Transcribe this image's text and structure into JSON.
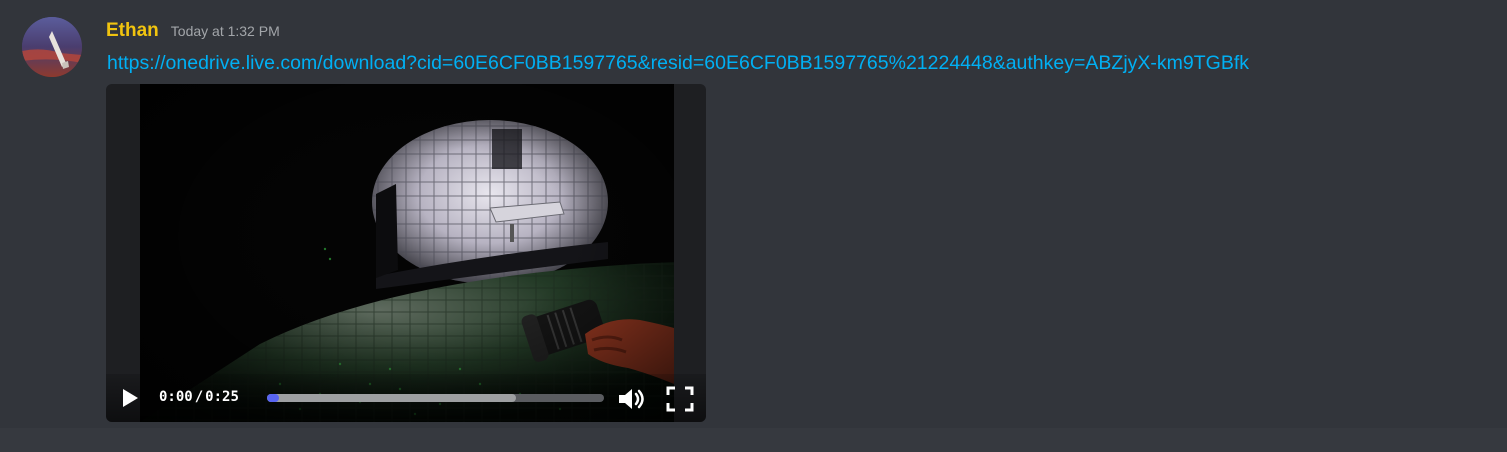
{
  "message": {
    "author": {
      "name": "Ethan",
      "name_color": "#f1c40f",
      "avatar_icon": "avatar-image"
    },
    "timestamp": "Today at 1:32 PM",
    "link_text": "https://onedrive.live.com/download?cid=60E6CF0BB1597765&resid=60E6CF0BB1597765%21224448&authkey=ABZjyX-km9TGBfk",
    "link_color": "#00b0f4"
  },
  "video_player": {
    "current_time": "0:00",
    "separator": "/",
    "duration": "0:25",
    "played_fraction": 0.0,
    "buffered_fraction": 0.74,
    "accent_color": "#5865f2",
    "icons": {
      "play": "play-icon",
      "volume": "volume-icon",
      "fullscreen": "fullscreen-icon"
    }
  },
  "colors": {
    "background": "#32353b",
    "timestamp": "#a3a6aa"
  }
}
